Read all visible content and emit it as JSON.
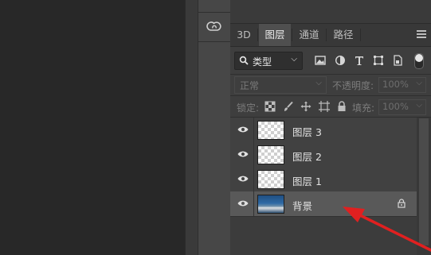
{
  "toolstrip": {
    "cc_icon": "creative-cloud-icon"
  },
  "panel": {
    "tabs": [
      {
        "label": "3D",
        "active": false
      },
      {
        "label": "图层",
        "active": true
      },
      {
        "label": "通道",
        "active": false
      },
      {
        "label": "路径",
        "active": false
      }
    ],
    "filter": {
      "search_icon": "search-icon",
      "kind_label": "类型"
    },
    "blend_mode": "正常",
    "opacity_label": "不透明度:",
    "opacity_value": "100%",
    "lock_label": "锁定:",
    "fill_label": "填充:",
    "fill_value": "100%",
    "layers": [
      {
        "name": "图层 3",
        "visible": true,
        "thumbnail": "transparent",
        "locked": false,
        "selected": false
      },
      {
        "name": "图层 2",
        "visible": true,
        "thumbnail": "transparent",
        "locked": false,
        "selected": false
      },
      {
        "name": "图层 1",
        "visible": true,
        "thumbnail": "transparent",
        "locked": false,
        "selected": false
      },
      {
        "name": "背景",
        "visible": true,
        "thumbnail": "photo",
        "locked": true,
        "selected": true
      }
    ]
  },
  "annotation": {
    "arrow_color": "#e02020"
  }
}
